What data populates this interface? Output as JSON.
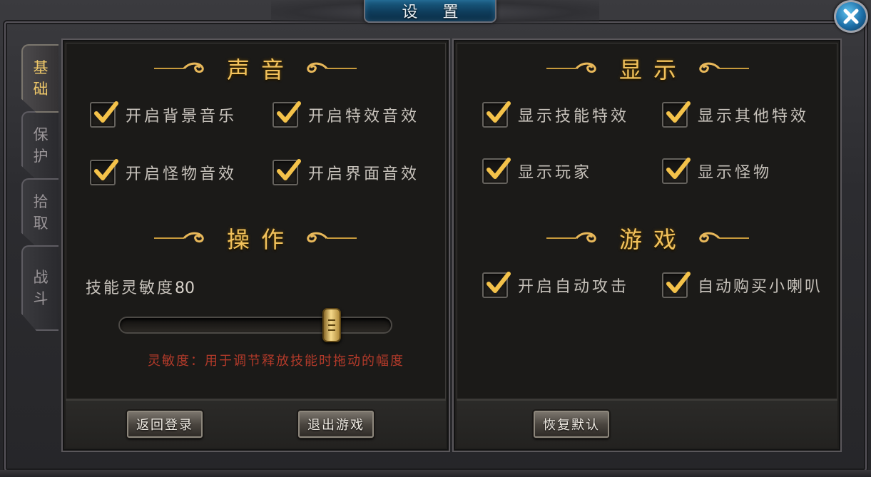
{
  "window": {
    "title": "设 置"
  },
  "tabs": [
    {
      "chars": [
        "基",
        "础"
      ],
      "active": true
    },
    {
      "chars": [
        "保",
        "护"
      ],
      "active": false
    },
    {
      "chars": [
        "拾",
        "取"
      ],
      "active": false
    },
    {
      "chars": [
        "战",
        "斗"
      ],
      "active": false
    }
  ],
  "sound": {
    "title": "声音",
    "options": [
      {
        "label": "开启背景音乐",
        "checked": true
      },
      {
        "label": "开启特效音效",
        "checked": true
      },
      {
        "label": "开启怪物音效",
        "checked": true
      },
      {
        "label": "开启界面音效",
        "checked": true
      }
    ]
  },
  "operation": {
    "title": "操作",
    "sensitivity_label": "技能灵敏度",
    "sensitivity_value": "80",
    "slider_fraction": 0.8,
    "hint": "灵敏度：用于调节释放技能时拖动的幅度"
  },
  "display": {
    "title": "显示",
    "options": [
      {
        "label": "显示技能特效",
        "checked": true
      },
      {
        "label": "显示其他特效",
        "checked": true
      },
      {
        "label": "显示玩家",
        "checked": true
      },
      {
        "label": "显示怪物",
        "checked": true
      }
    ]
  },
  "game": {
    "title": "游戏",
    "options": [
      {
        "label": "开启自动攻击",
        "checked": true
      },
      {
        "label": "自动购买小喇叭",
        "checked": true
      }
    ]
  },
  "buttons": {
    "back_login": "返回登录",
    "exit_game": "退出游戏",
    "restore_default": "恢复默认"
  },
  "colors": {
    "accent_gold": "#f2c25c",
    "hint_red": "#b33a2a",
    "title_plate_blue": "#1a5f86"
  }
}
